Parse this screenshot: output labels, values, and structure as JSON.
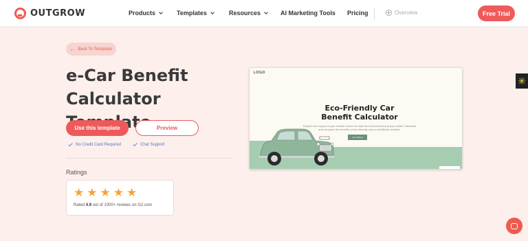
{
  "header": {
    "logo_text": "OUTGROW",
    "nav": [
      {
        "label": "Products",
        "has_dropdown": true
      },
      {
        "label": "Templates",
        "has_dropdown": true
      },
      {
        "label": "Resources",
        "has_dropdown": true
      },
      {
        "label": "AI Marketing Tools",
        "has_dropdown": false
      },
      {
        "label": "Pricing",
        "has_dropdown": false
      }
    ],
    "overview_label": "Overview",
    "cta_label": "Free Trial"
  },
  "main": {
    "back_label": "Back To Templates",
    "title": "e-Car Benefit Calculator Template",
    "use_button": "Use this template",
    "preview_button": "Preview",
    "perks": [
      "No Credit Card Required",
      "Chat Support"
    ],
    "ratings_label": "Ratings",
    "rating": {
      "stars": 5,
      "prefix": "Rated ",
      "score": "4.9",
      "suffix": " out of 1000+ reviews on G2.com"
    }
  },
  "preview": {
    "logo": "LOGO",
    "title": "Eco-Friendly Car Benefit Calculator",
    "description": "Explore the impact of your vehicle choice on both the environment and your wallet. Calculate and compare the benefits of eco-friendly cars to traditional vehicles.",
    "button": "Get Started"
  },
  "colors": {
    "accent": "#ef5a5a",
    "background": "#fcefec",
    "star": "#f5a43b",
    "preview_ground": "#a6cdb1",
    "car_body": "#8fb59a"
  },
  "icons": {
    "logo": "outgrow-logo-icon",
    "side_widget": "sun-icon",
    "chat": "chat-icon"
  }
}
